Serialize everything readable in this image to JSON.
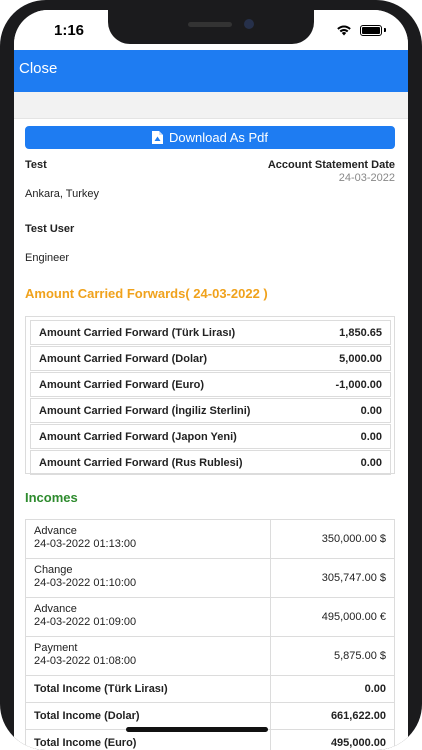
{
  "status_bar": {
    "time": "1:16"
  },
  "nav": {
    "close_label": "Close"
  },
  "download": {
    "label": "Download As Pdf"
  },
  "company": {
    "name": "Test",
    "city": "Ankara, Turkey"
  },
  "statement": {
    "label": "Account Statement Date",
    "date": "24-03-2022"
  },
  "user": {
    "name": "Test User",
    "title": "Engineer"
  },
  "carried": {
    "title": "Amount Carried Forwards( 24-03-2022 )",
    "rows": [
      {
        "label": "Amount Carried Forward (Türk Lirası)",
        "value": "1,850.65"
      },
      {
        "label": "Amount Carried Forward (Dolar)",
        "value": "5,000.00"
      },
      {
        "label": "Amount Carried Forward (Euro)",
        "value": "-1,000.00"
      },
      {
        "label": "Amount Carried Forward (İngiliz Sterlini)",
        "value": "0.00"
      },
      {
        "label": "Amount Carried Forward (Japon Yeni)",
        "value": "0.00"
      },
      {
        "label": "Amount Carried Forward (Rus Rublesi)",
        "value": "0.00"
      }
    ]
  },
  "incomes": {
    "title": "Incomes",
    "rows": [
      {
        "type": "Advance",
        "datetime": "24-03-2022 01:13:00",
        "amount": "350,000.00 $"
      },
      {
        "type": "Change",
        "datetime": "24-03-2022 01:10:00",
        "amount": "305,747.00 $"
      },
      {
        "type": "Advance",
        "datetime": "24-03-2022 01:09:00",
        "amount": "495,000.00 €"
      },
      {
        "type": "Payment",
        "datetime": "24-03-2022 01:08:00",
        "amount": "5,875.00 $"
      }
    ],
    "totals": [
      {
        "label": "Total Income (Türk Lirası)",
        "value": "0.00"
      },
      {
        "label": "Total Income (Dolar)",
        "value": "661,622.00"
      },
      {
        "label": "Total Income (Euro)",
        "value": "495,000.00"
      }
    ]
  },
  "colors": {
    "accent": "#1e7cf2",
    "orange": "#f0a21c",
    "green": "#2e8b2e"
  }
}
